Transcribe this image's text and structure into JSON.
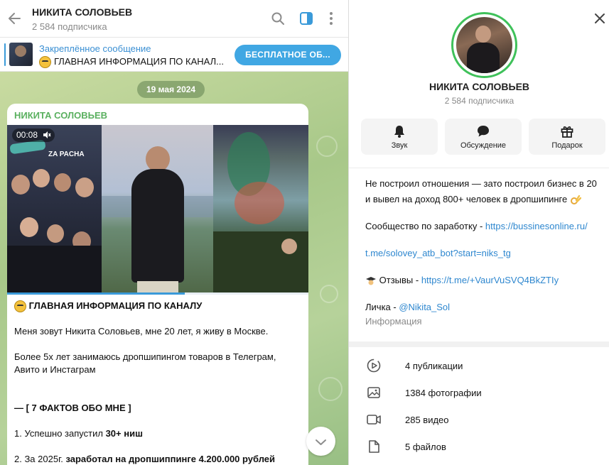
{
  "header": {
    "title": "НИКИТА СОЛОВЬЕВ",
    "subtitle": "2 584 подписчика"
  },
  "pinned": {
    "label": "Закреплённое сообщение",
    "text": "ГЛАВНАЯ ИНФОРМАЦИЯ ПО КАНАЛ...",
    "button_label": "БЕСПЛАТНОЕ ОБ..."
  },
  "chat": {
    "date_badge": "19 мая 2024",
    "message": {
      "author": "НИКИТА СОЛОВЬЕВ",
      "video_time": "00:08",
      "video_progress": 0.59,
      "headline": "ГЛАВНАЯ ИНФОРМАЦИЯ ПО КАНАЛУ",
      "intro": "Меня зовут Никита Соловьев, мне 20 лет, я живу в Москве.",
      "para2_line1": "Более 5х лет занимаюсь дропшипингом товаров в Телеграм,",
      "para2_line2": "Авито и Инстаграм",
      "facts_title": "— [ 7 ФАКТОВ ОБО МНЕ ]",
      "fact1_prefix": "1. Успешно запустил ",
      "fact1_bold": "30+ ниш",
      "fact2_prefix": "2. За 2025г. ",
      "fact2_bold": "заработал на дропшиппинге 4.200.000 рублей"
    }
  },
  "info": {
    "name": "НИКИТА СОЛОВЬЕВ",
    "subscribers": "2 584 подписчика",
    "actions": [
      {
        "label": "Звук",
        "icon": "bell-icon"
      },
      {
        "label": "Обсуждение",
        "icon": "chat-bubble-icon"
      },
      {
        "label": "Подарок",
        "icon": "gift-icon"
      }
    ],
    "description": {
      "line1": "Не построил отношения — зато построил бизнес в 20",
      "line2": "и вывел на доход 800+ человек в дропшипинге",
      "community_prefix": "Сообщество по заработку - ",
      "community_link": "https://bussinesonline.ru/",
      "bot_link": "t.me/solovey_atb_bot?start=niks_tg",
      "reviews_prefix": "Отзывы - ",
      "reviews_link": "https://t.me/+VaurVuSVQ4BkZTIy",
      "personal_prefix": "Личка - ",
      "personal_link": "@Nikita_Sol",
      "caption": "Информация"
    },
    "stats": [
      {
        "label": "4 публикации",
        "icon": "play-circle-icon"
      },
      {
        "label": "1384 фотографии",
        "icon": "image-icon"
      },
      {
        "label": "285 видео",
        "icon": "video-icon"
      },
      {
        "label": "5 файлов",
        "icon": "file-icon"
      }
    ]
  },
  "colors": {
    "accent": "#40a7e3",
    "author": "#5ab05f",
    "link": "#2e87cf",
    "avatar_ring": "#3fc15a"
  }
}
